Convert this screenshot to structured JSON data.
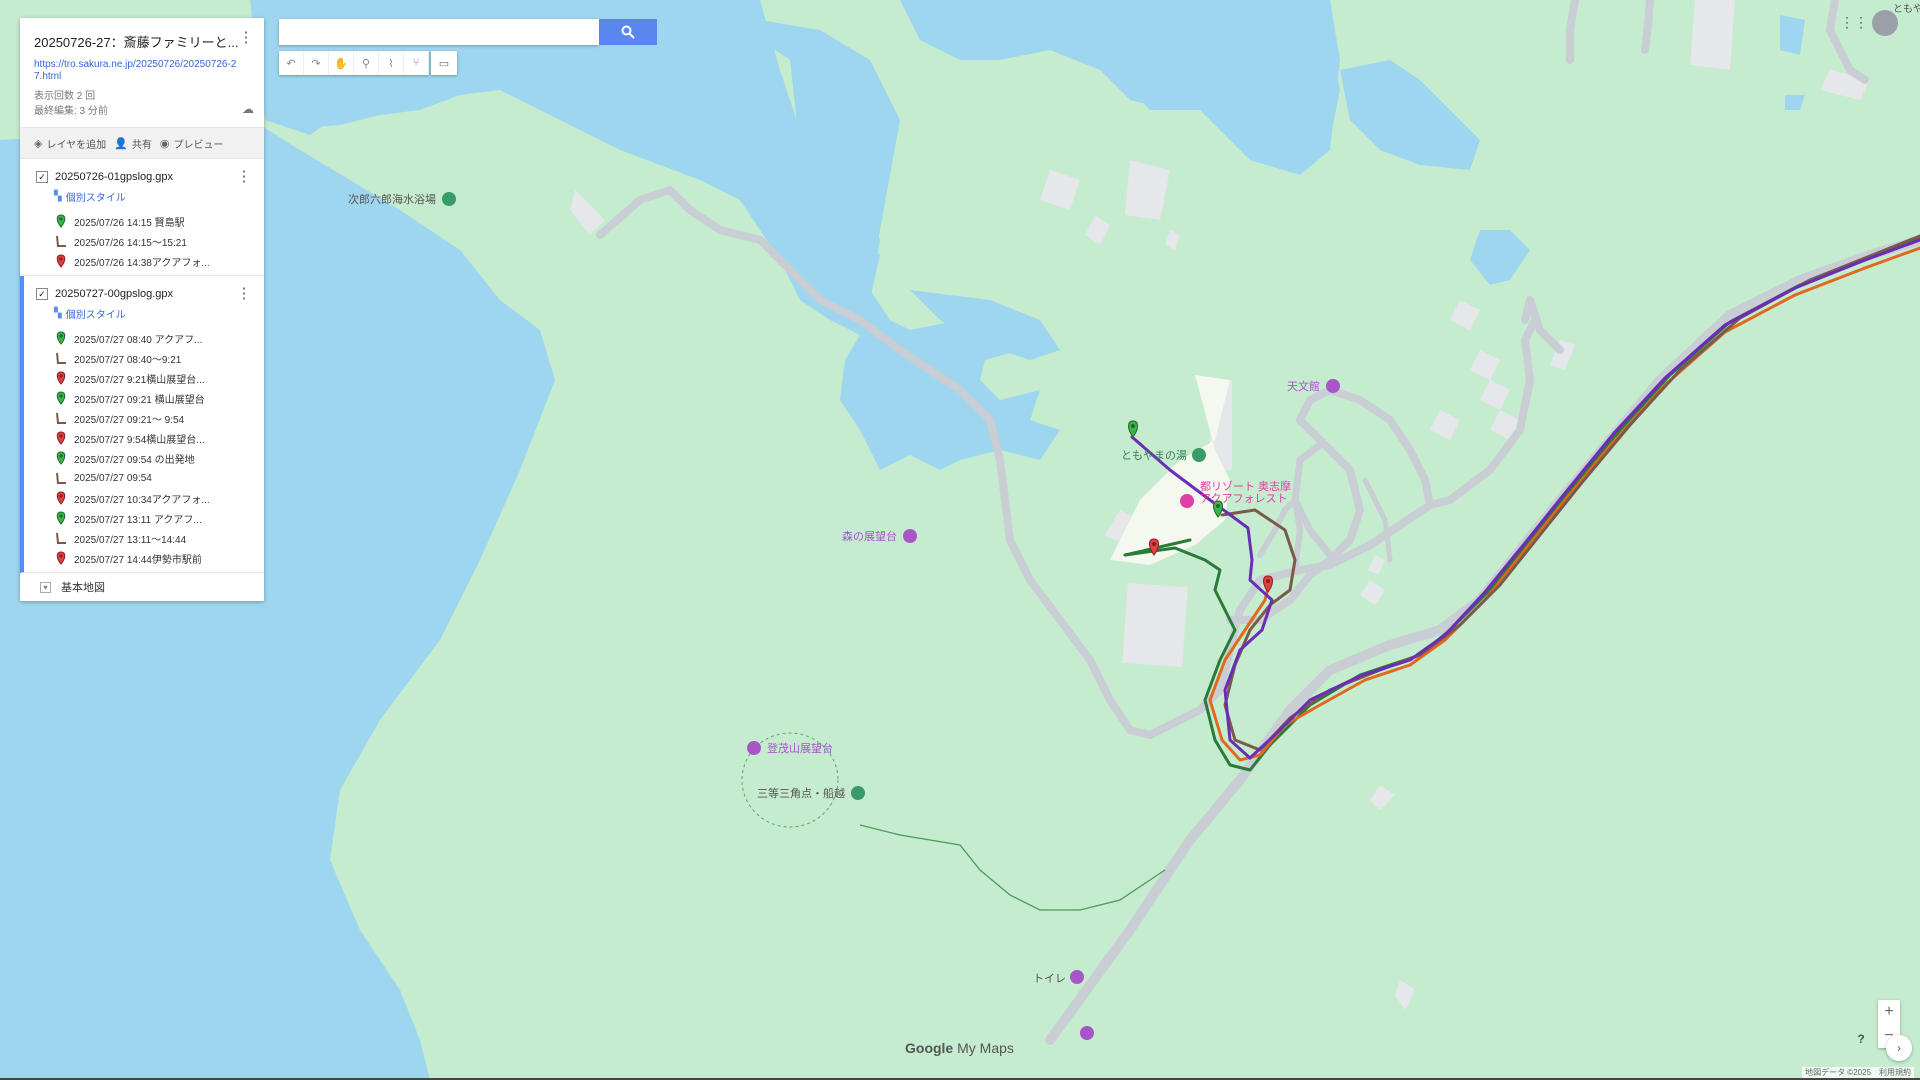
{
  "map": {
    "title": "20250726-27：斎藤ファミリーと...",
    "link": "https://tro.sakura.ne.jp/20250726/20250726-27.html",
    "views": "表示回数 2 回",
    "last_edit": "最終編集: 3 分前"
  },
  "toolbar": {
    "add_layer": "レイヤを追加",
    "share": "共有",
    "preview": "プレビュー"
  },
  "layers": [
    {
      "name": "20250726-01gpslog.gpx",
      "style": "個別スタイル",
      "items": [
        {
          "icon": "green-pin-icon",
          "text": "2025/07/26 14:15 賢島駅"
        },
        {
          "icon": "route-line-icon",
          "text": "2025/07/26 14:15〜15:21"
        },
        {
          "icon": "red-pin-icon",
          "text": "2025/07/26 14:38アクアフォ..."
        }
      ]
    },
    {
      "name": "20250727-00gpslog.gpx",
      "style": "個別スタイル",
      "items": [
        {
          "icon": "green-pin-icon",
          "text": "2025/07/27 08:40 アクアフ..."
        },
        {
          "icon": "route-line-icon",
          "text": "2025/07/27 08:40〜9:21"
        },
        {
          "icon": "red-pin-icon",
          "text": "2025/07/27 9:21横山展望台..."
        },
        {
          "icon": "green-pin-icon",
          "text": "2025/07/27 09:21 横山展望台"
        },
        {
          "icon": "route-line-icon",
          "text": "2025/07/27 09:21〜 9:54"
        },
        {
          "icon": "red-pin-icon",
          "text": "2025/07/27 9:54横山展望台..."
        },
        {
          "icon": "green-pin-icon",
          "text": "2025/07/27 09:54 の出発地"
        },
        {
          "icon": "route-line-icon",
          "text": "2025/07/27 09:54"
        },
        {
          "icon": "red-pin-icon",
          "text": "2025/07/27 10:34アクアフォ..."
        },
        {
          "icon": "green-pin-icon",
          "text": "2025/07/27 13:11 アクアフ..."
        },
        {
          "icon": "route-line-icon",
          "text": "2025/07/27 13:11〜14:44"
        },
        {
          "icon": "red-pin-icon",
          "text": "2025/07/27 14:44伊勢市駅前"
        }
      ]
    }
  ],
  "basemap": "基本地図",
  "search": {
    "placeholder": ""
  },
  "pois": {
    "beach": "次郎六郎海水浴場",
    "observatory_forest": "森の展望台",
    "tomoyama_observatory": "登茂山展望台",
    "triangulation": "三等三角点・船越",
    "planetarium": "天文館",
    "onsen": "ともやまの湯",
    "resort_line1": "都リゾート 奥志摩",
    "resort_line2": "アクアフォレスト",
    "toilet": "トイレ",
    "corner": "ともや"
  },
  "branding": {
    "google": "Google",
    "mymaps": "My Maps"
  },
  "attribution": {
    "data": "地図データ ©2025",
    "terms": "利用規約"
  },
  "zoom": {
    "in": "+",
    "out": "−"
  },
  "colors": {
    "water": "#9fd6ef",
    "land": "#c5eccf",
    "road": "#c9cdd4",
    "route_purple": "#6a2db8",
    "route_brown": "#7a5a4a",
    "route_orange": "#e0691f",
    "route_green": "#2a7a3a",
    "poi_purple": "#a855c8",
    "poi_green": "#3a9a6a"
  }
}
